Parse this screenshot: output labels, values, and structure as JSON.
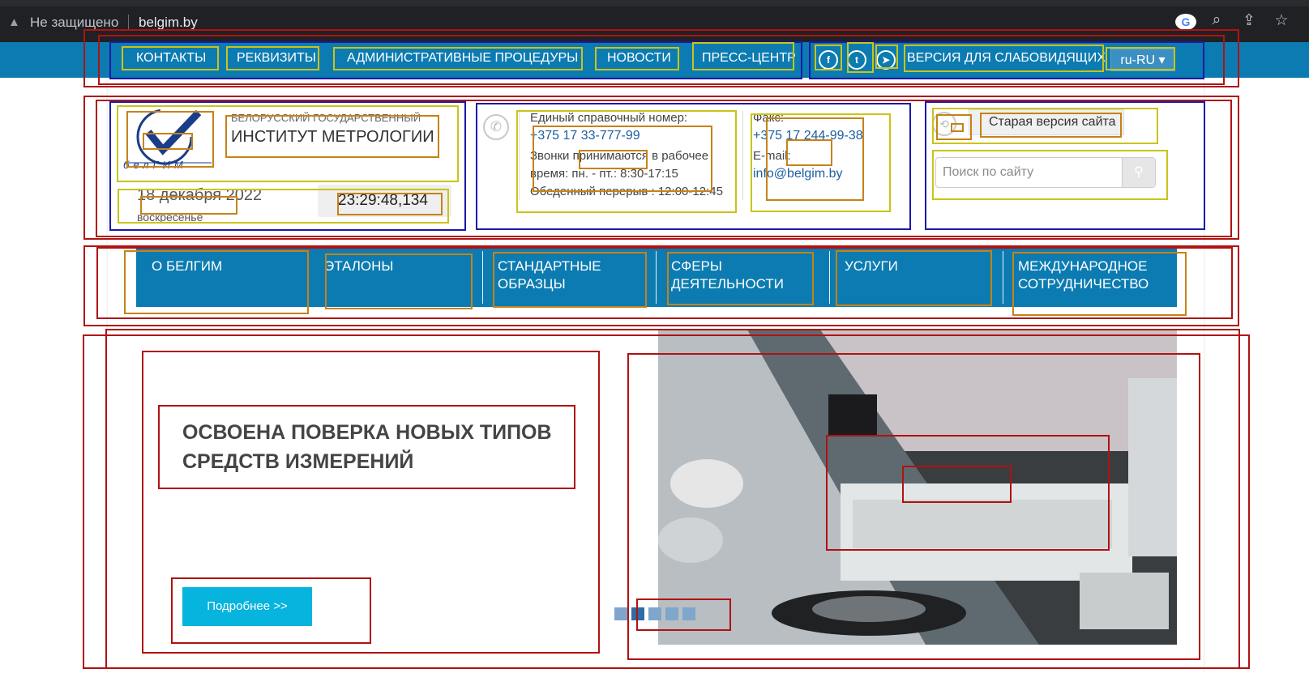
{
  "browser": {
    "warning_icon": "warning-triangle-icon",
    "security_label": "Не защищено",
    "url": "belgim.by",
    "icons": [
      "google-icon",
      "zoom-icon",
      "share-icon",
      "bookmark-star-icon"
    ]
  },
  "top_nav": {
    "items": [
      "КОНТАКТЫ",
      "РЕКВИЗИТЫ",
      "АДМИНИСТРАТИВНЫЕ ПРОЦЕДУРЫ",
      "НОВОСТИ",
      "ПРЕСС-ЦЕНТР"
    ],
    "social_icons": [
      "facebook-icon",
      "twitter-icon",
      "telegram-icon"
    ],
    "accessibility": "ВЕРСИЯ ДЛЯ СЛАБОВИДЯЩИХ",
    "language": "ru-RU"
  },
  "header": {
    "logo_text": "белГИМ",
    "org_subtitle": "БЕЛОРУССКИЙ ГОСУДАРСТВЕННЫЙ",
    "org_title": "ИНСТИТУТ МЕТРОЛОГИИ",
    "date": "18 декабря 2022",
    "weekday": "воскресенье",
    "time": "23:29:48,134"
  },
  "contacts": {
    "help_label": "Единый справочный номер:",
    "help_phone": "+375 17 33-777-99",
    "hours_line1": "Звонки принимаются в рабочее",
    "hours_line2": "время: пн. - пт.: 8:30-17:15",
    "lunch": "Обеденный перерыв : 12:00-12:45",
    "fax_label": "Факс:",
    "fax": "+375 17 244-99-38",
    "email_label": "E-mail:",
    "email": "info@belgim.by"
  },
  "site_tools": {
    "old_version": "Старая версия сайта",
    "search_placeholder": "Поиск по сайту"
  },
  "main_nav": [
    {
      "line1": "О БЕЛГИМ",
      "line2": ""
    },
    {
      "line1": "ЭТАЛОНЫ",
      "line2": ""
    },
    {
      "line1": "СТАНДАРТНЫЕ",
      "line2": "ОБРАЗЦЫ"
    },
    {
      "line1": "СФЕРЫ",
      "line2": "ДЕЯТЕЛЬНОСТИ"
    },
    {
      "line1": "УСЛУГИ",
      "line2": ""
    },
    {
      "line1": "МЕЖДУНАРОДНОЕ",
      "line2": "СОТРУДНИЧЕСТВО"
    }
  ],
  "slider": {
    "title_line1": "ОСВОЕНА ПОВЕРКА НОВЫХ ТИПОВ",
    "title_line2": "СРЕДСТВ ИЗМЕРЕНИЙ",
    "button": "Подробнее >>",
    "dots_count": 5,
    "active_dot": 1
  },
  "colors": {
    "primary_blue": "#0c7bb1",
    "button_cyan": "#06b4de",
    "annotation_red": "#b01212",
    "annotation_blue": "#1a1aa8",
    "annotation_yellow": "#c9c419",
    "annotation_orange": "#c68217"
  }
}
